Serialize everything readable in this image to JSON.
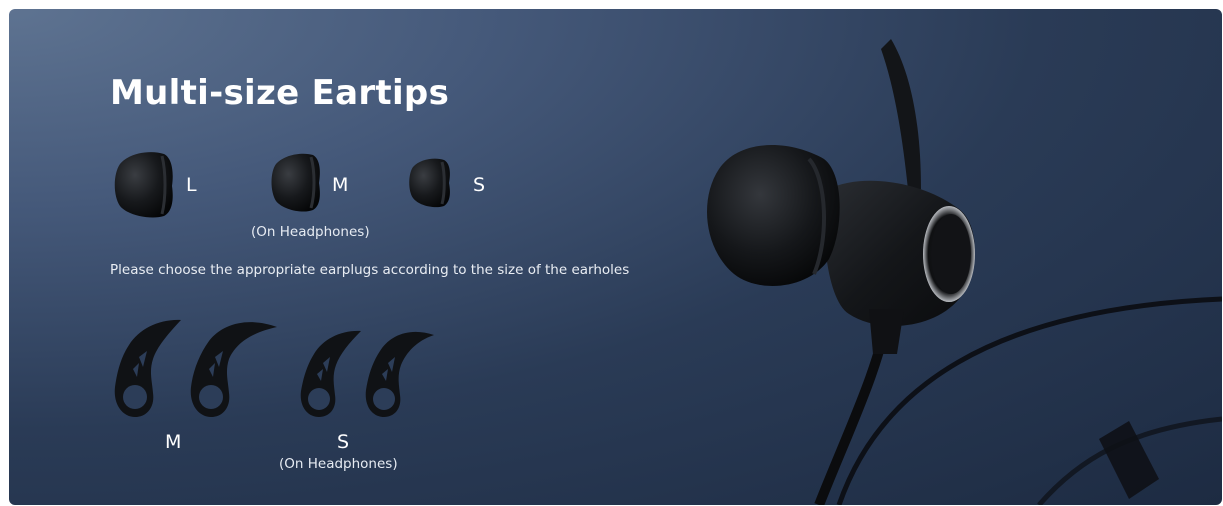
{
  "banner": {
    "title": "Multi-size Eartips",
    "eartips": [
      {
        "size": "L"
      },
      {
        "size": "M"
      },
      {
        "size": "S"
      }
    ],
    "eartip_note": "(On Headphones)",
    "instruction": "Please choose the appropriate earplugs according to the size of the earholes",
    "earhooks": [
      {
        "size": "M"
      },
      {
        "size": "S"
      }
    ],
    "earhook_note": "(On Headphones)",
    "colors": {
      "background_light": "#5e7391",
      "background_dark": "#1d2b42",
      "text": "#ffffff",
      "product": "#121417"
    }
  }
}
